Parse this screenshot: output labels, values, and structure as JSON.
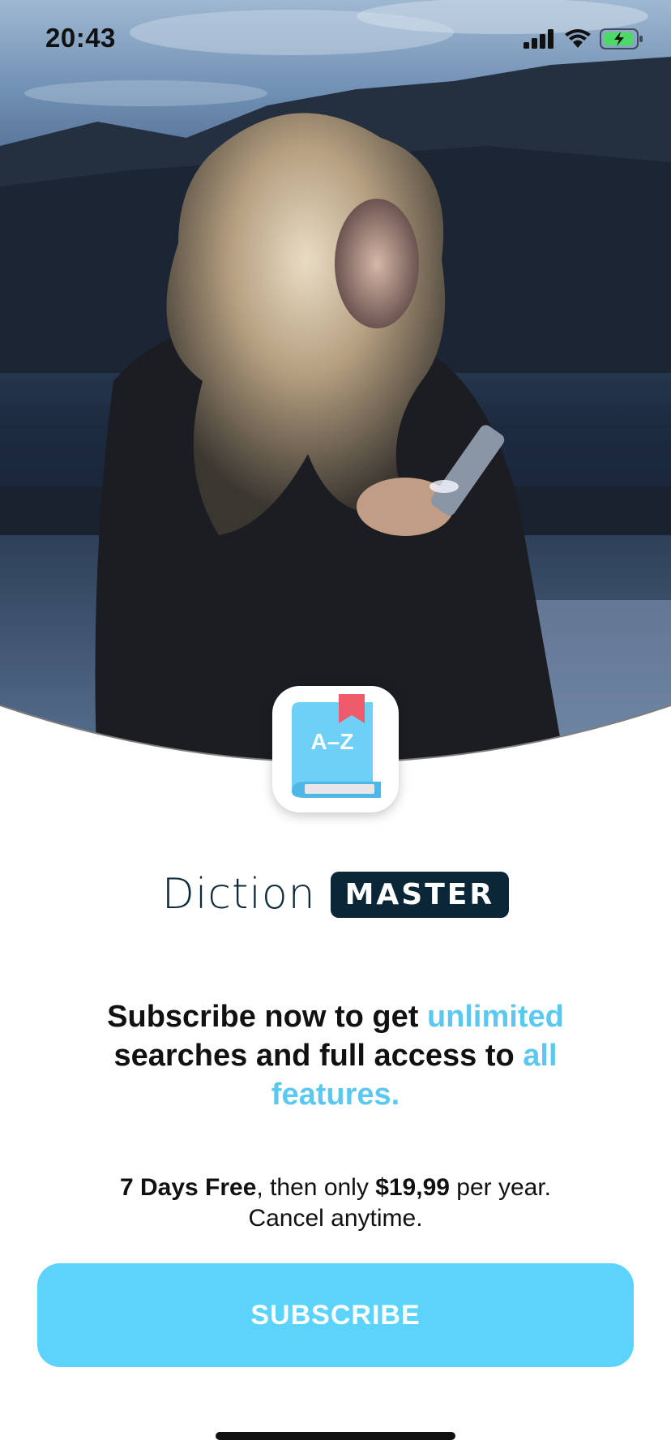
{
  "status_bar": {
    "time": "20:43",
    "icons": [
      "cellular-signal-icon",
      "wifi-icon",
      "battery-charging-icon"
    ],
    "battery_color": "#4cd964"
  },
  "hero": {
    "image": "woman-reading-phone-at-dusk"
  },
  "app_icon": {
    "label": "A–Z",
    "icon": "dictionary-book-icon",
    "book_color": "#6fd0f7",
    "bookmark_color": "#ef5b6b"
  },
  "brand": {
    "name": "Diction",
    "badge": "MASTER"
  },
  "headline": {
    "part1": "Subscribe now to get ",
    "accent1": "unlimited",
    "part2": " searches and full access to ",
    "accent2": "all features."
  },
  "pricing": {
    "trial": "7 Days Free",
    "middle": ", then only ",
    "price": "$19,99",
    "period": " per year.",
    "cancel": "Cancel anytime."
  },
  "subscribe_button": {
    "label": "SUBSCRIBE"
  },
  "colors": {
    "accent": "#5bc8f1",
    "button": "#5bd3fb",
    "brand_dark": "#0b2737"
  }
}
